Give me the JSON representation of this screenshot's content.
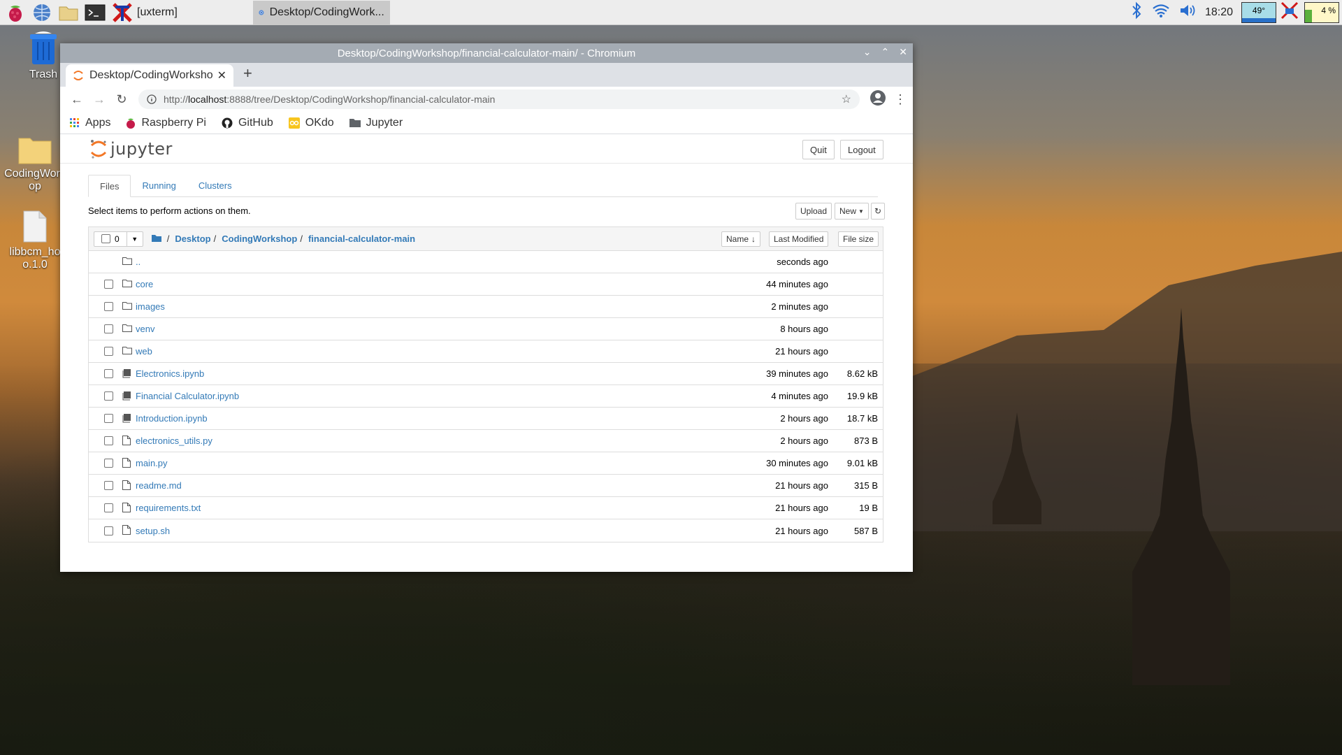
{
  "taskbar": {
    "tasks": [
      {
        "label": "[uxterm]",
        "active": false
      },
      {
        "label": "Desktop/CodingWork...",
        "active": true
      }
    ],
    "clock": "18:20",
    "temperature": "49°",
    "cpu": "4 %"
  },
  "desktop": {
    "icons": [
      {
        "label": "Trash"
      },
      {
        "label": "CodingWork\nop"
      },
      {
        "label": "libbcm_ho\no.1.0"
      }
    ]
  },
  "window": {
    "title": "Desktop/CodingWorkshop/financial-calculator-main/ - Chromium"
  },
  "browser": {
    "tab_title": "Desktop/CodingWorksho",
    "url_prefix": "http://",
    "url_host": "localhost",
    "url_rest": ":8888/tree/Desktop/CodingWorkshop/financial-calculator-main",
    "bookmarks": [
      {
        "label": "Apps",
        "icon": "apps-grid-icon"
      },
      {
        "label": "Raspberry Pi",
        "icon": "raspberry-icon"
      },
      {
        "label": "GitHub",
        "icon": "github-icon"
      },
      {
        "label": "OKdo",
        "icon": "okdo-icon"
      },
      {
        "label": "Jupyter",
        "icon": "folder-icon"
      }
    ]
  },
  "jupyter": {
    "logo_text": "jupyter",
    "quit_label": "Quit",
    "logout_label": "Logout",
    "tabs": [
      "Files",
      "Running",
      "Clusters"
    ],
    "hint": "Select items to perform actions on them.",
    "upload_label": "Upload",
    "new_label": "New",
    "selected_count": "0",
    "breadcrumb": [
      "Desktop",
      "CodingWorkshop",
      "financial-calculator-main"
    ],
    "sort_name": "Name",
    "sort_modified": "Last Modified",
    "sort_size": "File size",
    "files": [
      {
        "name": "..",
        "type": "folder",
        "modified": "seconds ago",
        "size": "",
        "checkbox": false
      },
      {
        "name": "core",
        "type": "folder",
        "modified": "44 minutes ago",
        "size": "",
        "checkbox": true
      },
      {
        "name": "images",
        "type": "folder",
        "modified": "2 minutes ago",
        "size": "",
        "checkbox": true
      },
      {
        "name": "venv",
        "type": "folder",
        "modified": "8 hours ago",
        "size": "",
        "checkbox": true
      },
      {
        "name": "web",
        "type": "folder",
        "modified": "21 hours ago",
        "size": "",
        "checkbox": true
      },
      {
        "name": "Electronics.ipynb",
        "type": "notebook",
        "modified": "39 minutes ago",
        "size": "8.62 kB",
        "checkbox": true
      },
      {
        "name": "Financial Calculator.ipynb",
        "type": "notebook",
        "modified": "4 minutes ago",
        "size": "19.9 kB",
        "checkbox": true
      },
      {
        "name": "Introduction.ipynb",
        "type": "notebook",
        "modified": "2 hours ago",
        "size": "18.7 kB",
        "checkbox": true
      },
      {
        "name": "electronics_utils.py",
        "type": "file",
        "modified": "2 hours ago",
        "size": "873 B",
        "checkbox": true
      },
      {
        "name": "main.py",
        "type": "file",
        "modified": "30 minutes ago",
        "size": "9.01 kB",
        "checkbox": true
      },
      {
        "name": "readme.md",
        "type": "file",
        "modified": "21 hours ago",
        "size": "315 B",
        "checkbox": true
      },
      {
        "name": "requirements.txt",
        "type": "file",
        "modified": "21 hours ago",
        "size": "19 B",
        "checkbox": true
      },
      {
        "name": "setup.sh",
        "type": "file",
        "modified": "21 hours ago",
        "size": "587 B",
        "checkbox": true
      }
    ]
  }
}
